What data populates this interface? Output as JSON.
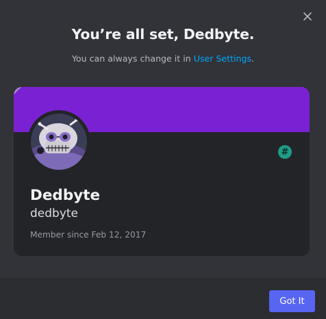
{
  "modal": {
    "title": "You’re all set, Dedbyte.",
    "subtitle_prefix": "You can always change it in ",
    "subtitle_link": "User Settings",
    "subtitle_suffix": ".",
    "close_icon": "close-icon"
  },
  "profile": {
    "banner_color": "#7b21d4",
    "avatar_icon": "skull-avatar",
    "badge_icon": "hashtag-icon",
    "badge_glyph": "#",
    "display_name": "Dedbyte",
    "username": "dedbyte",
    "member_since": "Member since Feb 12, 2017"
  },
  "footer": {
    "got_it_label": "Got It",
    "button_color": "#5865f2"
  }
}
